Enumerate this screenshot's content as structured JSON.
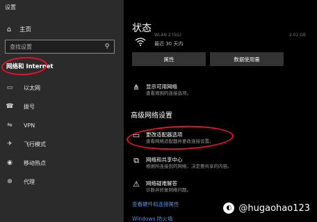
{
  "sidebar": {
    "window_title": "设置",
    "home_label": "主页",
    "search_placeholder": "查找设置",
    "section_title": "网络和 Internet",
    "items": [
      {
        "label": "以太网"
      },
      {
        "label": "拨号"
      },
      {
        "label": "VPN"
      },
      {
        "label": "飞行模式"
      },
      {
        "label": "移动热点"
      },
      {
        "label": "代理"
      }
    ]
  },
  "main": {
    "title": "状态",
    "network_name_partial": "WLAN 2 (5G)",
    "data_used_partial": "2.02 GB",
    "last_days": "最近 30 天内",
    "properties_button": "属性",
    "data_usage_button": "数据使用量",
    "show_networks": {
      "title": "显示可用网络",
      "desc": "查看周围的连接选项。"
    },
    "advanced_heading": "高级网络设置",
    "change_adapter": {
      "title": "更改适配器选项",
      "desc": "查看网络适配器并更改连接设置。"
    },
    "sharing_center": {
      "title": "网络和共享中心",
      "desc": "根据所连接到的网络，决定要共享的内容。"
    },
    "troubleshooter": {
      "title": "网络疑难解答",
      "desc": "诊断并修复网络问题。"
    },
    "hardware_link": "查看硬件和连接属性",
    "firewall_link": "Windows 防火墙"
  },
  "watermark": {
    "text": "@hugaohao123"
  },
  "colors": {
    "annotation_red": "#e8102a",
    "link_blue": "#5f8fd6"
  }
}
